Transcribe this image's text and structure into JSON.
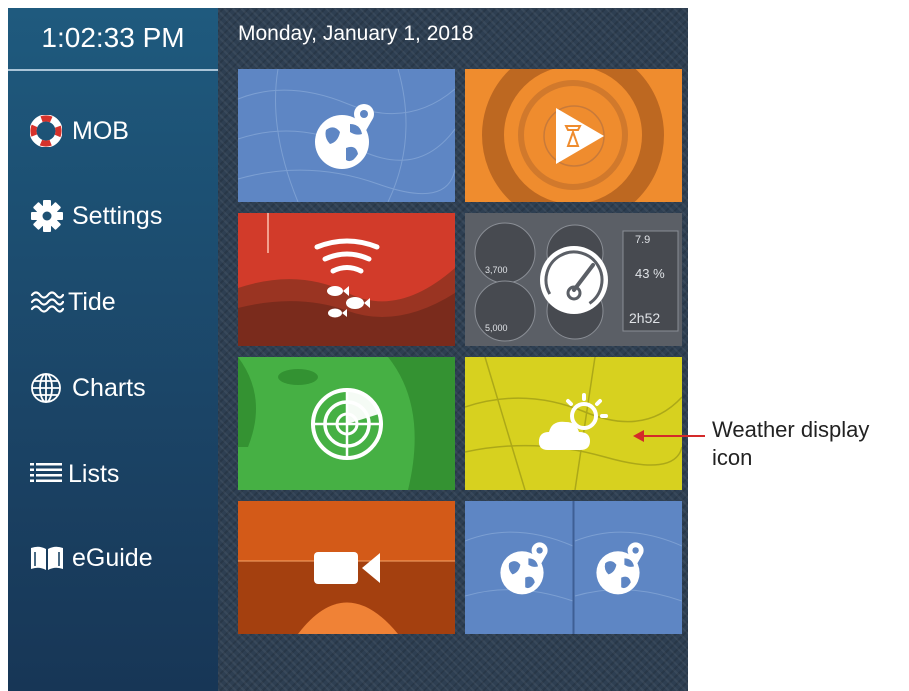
{
  "sidebar": {
    "clock": "1:02:33 PM",
    "items": [
      {
        "label": "MOB",
        "icon": "life-ring-icon"
      },
      {
        "label": "Settings",
        "icon": "gear-icon"
      },
      {
        "label": "Tide",
        "icon": "waves-icon"
      },
      {
        "label": "Charts",
        "icon": "globe-icon"
      },
      {
        "label": "Lists",
        "icon": "list-icon"
      },
      {
        "label": "eGuide",
        "icon": "book-icon"
      }
    ]
  },
  "main": {
    "date": "Monday, January 1, 2018",
    "tiles": [
      {
        "name": "chart",
        "icon": "globe-pin-icon",
        "color": "#5e86c4"
      },
      {
        "name": "sonar-plotter",
        "icon": "play-transducer-icon",
        "color": "#ef8c2e"
      },
      {
        "name": "fish-finder",
        "icon": "sonar-fish-icon",
        "color": "#d23b2a"
      },
      {
        "name": "instruments",
        "icon": "gauge-icon",
        "color": "#5b5f66"
      },
      {
        "name": "radar",
        "icon": "radar-icon",
        "color": "#46b044"
      },
      {
        "name": "weather",
        "icon": "weather-icon",
        "color": "#d7d11f"
      },
      {
        "name": "camera",
        "icon": "video-camera-icon",
        "color": "#e86a1f"
      },
      {
        "name": "dual-chart",
        "icon": "globe-pin-icon",
        "color": "#5e86c4"
      }
    ]
  },
  "callout": {
    "text": "Weather display icon",
    "color": "#d42a2a"
  }
}
